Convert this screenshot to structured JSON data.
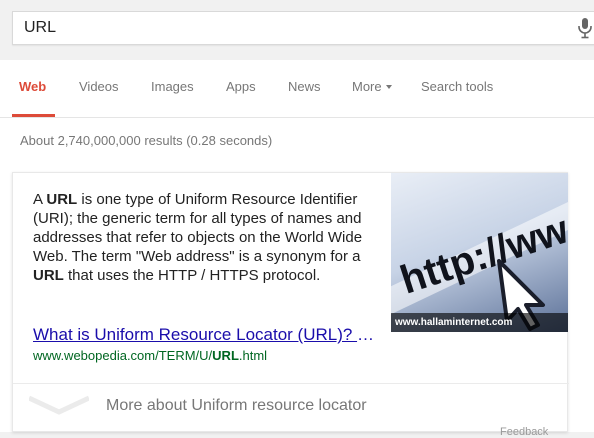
{
  "search": {
    "query": "URL"
  },
  "tabs": [
    {
      "label": "Web",
      "active": true
    },
    {
      "label": "Videos",
      "active": false
    },
    {
      "label": "Images",
      "active": false
    },
    {
      "label": "Apps",
      "active": false
    },
    {
      "label": "News",
      "active": false
    },
    {
      "label": "More",
      "active": false
    },
    {
      "label": "Search tools",
      "active": false
    }
  ],
  "stats": "About 2,740,000,000 results (0.28 seconds)",
  "knowledge_card": {
    "description": {
      "a": "A ",
      "b1": "URL",
      "c": " is one type of Uniform Resource Identifier (URI); the generic term for all types of names and addresses that refer to objects on the World Wide Web. The term \"Web address\" is a synonym for a ",
      "b2": "URL",
      "d": " that uses the HTTP / HTTPS protocol."
    },
    "link_title": "What is Uniform Resource Locator (URL)? Webopedia Definition",
    "link_url": {
      "pre": "www.webopedia.com/TERM/U/",
      "bold": "URL",
      "post": ".html"
    },
    "image_text": "http://ww",
    "image_caption": "www.hallaminternet.com",
    "more_about": "More about Uniform resource locator"
  },
  "feedback": "Feedback",
  "colors": {
    "active_tab": "#dd4b39",
    "link": "#1a0dab",
    "url_green": "#006621",
    "muted": "#777777"
  }
}
